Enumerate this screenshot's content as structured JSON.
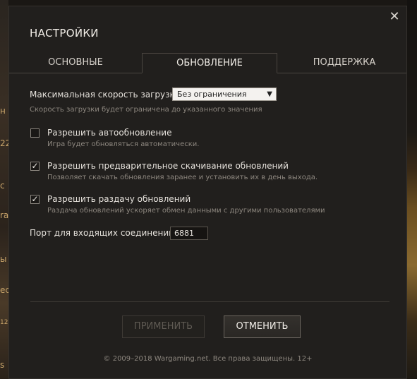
{
  "window": {
    "title": "НАСТРОЙКИ",
    "close_icon": "close-icon"
  },
  "tabs": [
    {
      "label": "ОСНОВНЫЕ",
      "active": false
    },
    {
      "label": "ОБНОВЛЕНИЕ",
      "active": true
    },
    {
      "label": "ПОДДЕРЖКА",
      "active": false
    }
  ],
  "download_speed": {
    "label": "Максимальная скорость загрузки:",
    "selected": "Без ограничения",
    "hint": "Скорость загрузки будет ограничена до указанного значения"
  },
  "options": [
    {
      "label": "Разрешить автообновление",
      "hint": "Игра будет обновляться автоматически.",
      "checked": false
    },
    {
      "label": "Разрешить предварительное скачивание обновлений",
      "hint": "Позволяет скачать обновления заранее и установить их в день выхода.",
      "checked": true
    },
    {
      "label": "Разрешить раздачу обновлений",
      "hint": "Раздача обновлений ускоряет обмен данными с другими пользователями",
      "checked": true
    }
  ],
  "port": {
    "label": "Порт для входящих соединений:",
    "value": "6881"
  },
  "buttons": {
    "apply": "ПРИМЕНИТЬ",
    "cancel": "ОТМЕНИТЬ"
  },
  "footer": "© 2009–2018 Wargaming.net. Все права защищены. 12+",
  "background_fragments": [
    "н",
    "22",
    "с",
    "ra",
    "ы",
    "ес",
    "12",
    "s"
  ],
  "colors": {
    "dialog_bg": "#211f1d",
    "text": "#e6e2dc",
    "hint": "#8d877f"
  }
}
